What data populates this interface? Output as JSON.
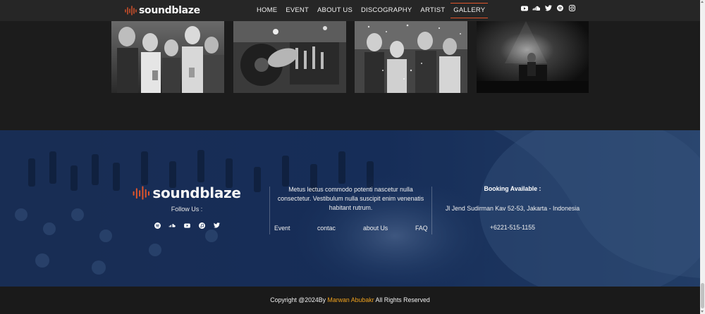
{
  "brand": {
    "name": "soundblaze",
    "accent_color": "#e0552b",
    "highlight_color": "#f0a21e"
  },
  "nav": {
    "items": [
      {
        "label": "HOME"
      },
      {
        "label": "EVENT"
      },
      {
        "label": "ABOUT US"
      },
      {
        "label": "DISCOGRAPHY"
      },
      {
        "label": "ARTIST"
      },
      {
        "label": "GALLERY",
        "active": true
      }
    ],
    "social_icons": [
      "youtube-icon",
      "soundcloud-icon",
      "twitter-icon",
      "spotify-icon",
      "instagram-icon"
    ]
  },
  "gallery": {
    "photos": [
      "party-crowd-photo",
      "dj-mixer-photo",
      "confetti-party-photo",
      "dj-stage-photo"
    ]
  },
  "footer": {
    "follow_label": "Follow Us :",
    "social_icons": [
      "spotify-icon",
      "soundcloud-icon",
      "youtube-icon",
      "apple-music-icon",
      "twitter-icon"
    ],
    "about_text": "Metus lectus commodo potenti nascetur nulla consectetur. Vestibulum nulla suscipit enim venenatis habitant rutrum.",
    "links": [
      {
        "label": "Event"
      },
      {
        "label": "contac"
      },
      {
        "label": "about Us"
      },
      {
        "label": "FAQ"
      }
    ],
    "booking_title": "Booking Available :",
    "address": "Jl Jend Sudirman Kav 52-53, Jakarta - Indonesia",
    "phone": "+6221-515-1155"
  },
  "copyright": {
    "prefix": "Copyright @2024By ",
    "author": "Marwan Abubakr",
    "suffix": " All Rights Reserved"
  }
}
